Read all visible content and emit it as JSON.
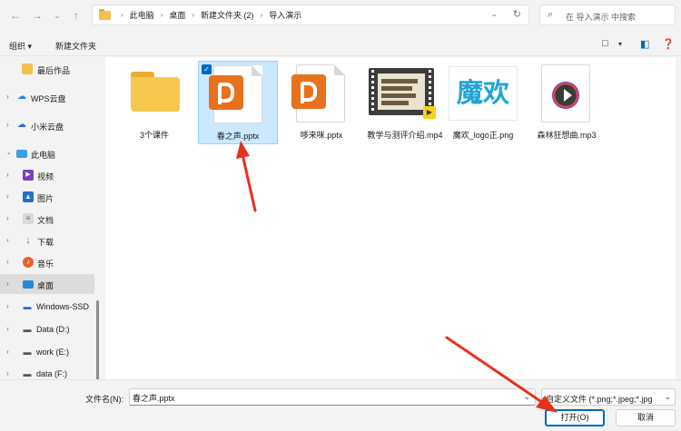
{
  "address": {
    "crumbs": [
      "此电脑",
      "桌面",
      "新建文件夹 (2)",
      "导入演示"
    ]
  },
  "search": {
    "placeholder": "在 导入演示 中搜索"
  },
  "toolbar": {
    "organize": "组织 ▾",
    "new_folder": "新建文件夹"
  },
  "sidebar": {
    "items": [
      {
        "label": "最后作品",
        "icon": "folder-icon"
      },
      {
        "label": "WPS云盘",
        "icon": "cloud-icon"
      },
      {
        "label": "小米云盘",
        "icon": "cloud-icon"
      },
      {
        "label": "此电脑",
        "icon": "pc-icon"
      },
      {
        "label": "视频",
        "icon": "video-icon"
      },
      {
        "label": "图片",
        "icon": "picture-icon"
      },
      {
        "label": "文档",
        "icon": "document-icon"
      },
      {
        "label": "下载",
        "icon": "download-icon"
      },
      {
        "label": "音乐",
        "icon": "music-icon"
      },
      {
        "label": "桌面",
        "icon": "desktop-icon"
      },
      {
        "label": "Windows-SSD",
        "icon": "drive-icon"
      },
      {
        "label": "Data (D:)",
        "icon": "drive-icon"
      },
      {
        "label": "work (E:)",
        "icon": "drive-icon"
      },
      {
        "label": "data (F:)",
        "icon": "drive-icon"
      }
    ]
  },
  "files": [
    {
      "name": "3个课件",
      "type": "folder"
    },
    {
      "name": "春之声.pptx",
      "type": "pptx",
      "selected": true
    },
    {
      "name": "哆来咪.pptx",
      "type": "pptx"
    },
    {
      "name": "教学与测评介绍.mp4",
      "type": "video"
    },
    {
      "name": "魔欢_logo正.png",
      "type": "image"
    },
    {
      "name": "森林狂想曲.mp3",
      "type": "audio"
    }
  ],
  "logo_text": "魔欢",
  "bottom": {
    "filename_label": "文件名(N):",
    "filename_value": "春之声.pptx",
    "filter_value": "自定义文件 (*.png;*.jpeg;*.jpg",
    "open_label": "打开(O)",
    "cancel_label": "取消"
  },
  "colors": {
    "accent": "#0067c0",
    "selection": "#cce8ff",
    "annotation_arrow": "#e8321e"
  }
}
